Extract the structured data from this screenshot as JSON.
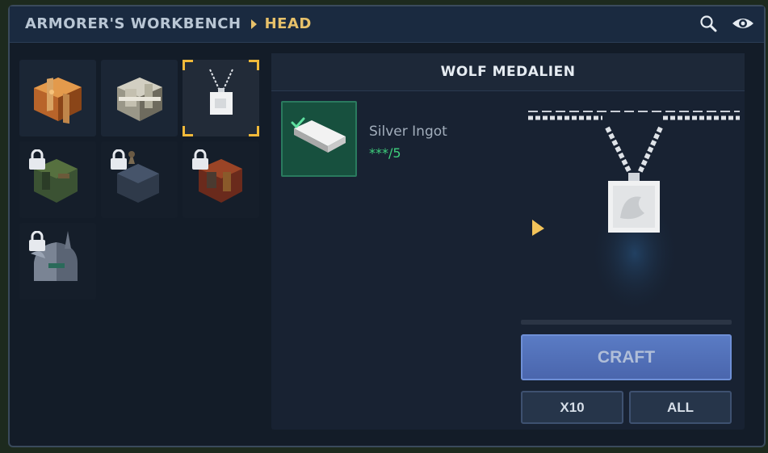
{
  "breadcrumb": {
    "bench": "ARMORER'S WORKBENCH",
    "category": "HEAD"
  },
  "header_icons": [
    "search-icon",
    "eye-icon"
  ],
  "recipes": [
    {
      "name": "copper-chest-armor-icon",
      "locked": false,
      "selected": false
    },
    {
      "name": "iron-chest-armor-icon",
      "locked": false,
      "selected": false
    },
    {
      "name": "wolf-medallion-icon",
      "locked": false,
      "selected": true
    },
    {
      "name": "green-chest-armor-icon",
      "locked": true,
      "selected": false
    },
    {
      "name": "dark-feather-armor-icon",
      "locked": true,
      "selected": false
    },
    {
      "name": "red-chest-armor-icon",
      "locked": true,
      "selected": false
    },
    {
      "name": "winged-helmet-icon",
      "locked": true,
      "selected": false
    }
  ],
  "item": {
    "title": "WOLF MEDALIEN",
    "ingredient": {
      "name": "Silver Ingot",
      "quantity": "***/5",
      "satisfied": true
    }
  },
  "progress": 0,
  "buttons": {
    "craft": "CRAFT",
    "x10": "X10",
    "all": "ALL"
  },
  "colors": {
    "accent": "#e7c16a",
    "craft": "#5a7bc4",
    "ok": "#3ecf7c"
  }
}
